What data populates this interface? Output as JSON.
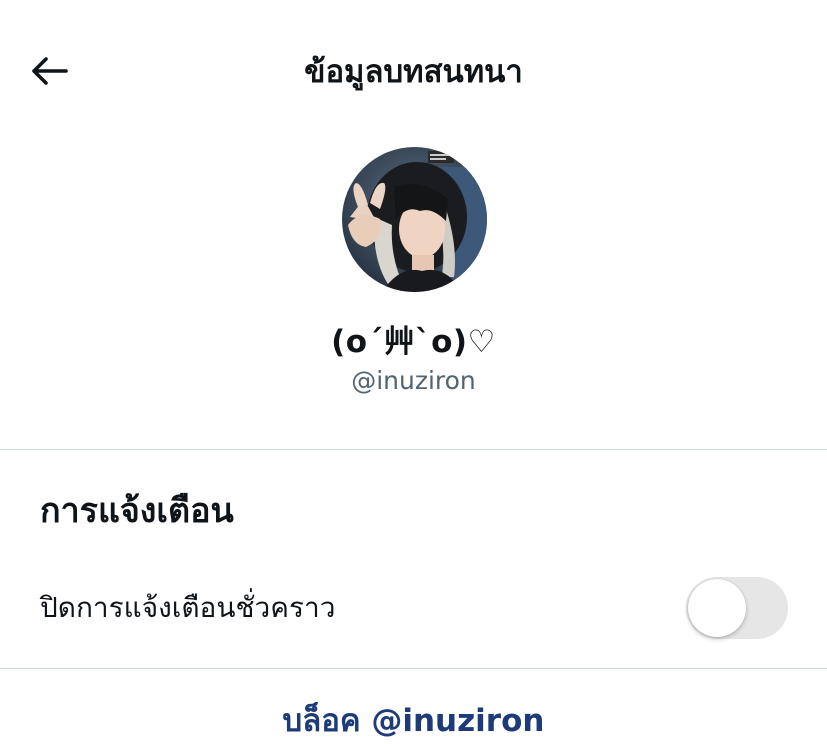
{
  "header": {
    "back_icon": "arrow-left-icon",
    "title": "ข้อมูลบทสนทนา"
  },
  "profile": {
    "avatar_icon": "user-avatar-photo",
    "display_name": "(o´艸`o)♡",
    "username": "@inuziron"
  },
  "notifications": {
    "heading": "การแจ้งเตือน",
    "snooze_label": "ปิดการแจ้งเตือนชั่วคราว",
    "snooze_enabled": false
  },
  "actions": {
    "block_label": "บล็อค @inuziron"
  },
  "colors": {
    "text_primary": "#0f1419",
    "text_secondary": "#536471",
    "divider": "#cfd9de",
    "toggle_off": "#e6e6e6",
    "block_link": "#1d3b78"
  }
}
